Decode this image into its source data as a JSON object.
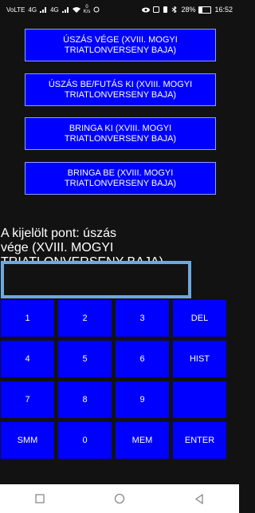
{
  "status_bar": {
    "left_labels": [
      "VoLTE",
      "4G",
      "4G"
    ],
    "speed_value": "0",
    "speed_unit": "K/s",
    "battery": "28%",
    "battery_fraction": 0.28,
    "time": "16:52"
  },
  "point_buttons": [
    {
      "line1": "ÚSZÁS VÉGE (XVIII. MOGYI",
      "line2": "TRIATLONVERSENY BAJA)"
    },
    {
      "line1": "ÚSZÁS BE/FUTÁS KI (XVIII. MOGYI",
      "line2": "TRIATLONVERSENY BAJA)"
    },
    {
      "line1": "BRINGA KI (XVIII. MOGYI",
      "line2": "TRIATLONVERSENY BAJA)"
    },
    {
      "line1": "BRINGA BE (XVIII. MOGYI",
      "line2": "TRIATLONVERSENY BAJA)"
    }
  ],
  "selected_point": {
    "line1": "A kijelölt pont: úszás",
    "line2": "vége (XVIII. MOGYI",
    "line3": "TRIATLONVERSENY BAJA)"
  },
  "input": {
    "value": ""
  },
  "keypad": [
    {
      "label": "1"
    },
    {
      "label": "2"
    },
    {
      "label": "3"
    },
    {
      "label": "DEL"
    },
    {
      "label": "4"
    },
    {
      "label": "5"
    },
    {
      "label": "6"
    },
    {
      "label": "HIST"
    },
    {
      "label": "7"
    },
    {
      "label": "8"
    },
    {
      "label": "9"
    },
    {
      "label": ""
    },
    {
      "label": "SMM"
    },
    {
      "label": "0"
    },
    {
      "label": "MEM"
    },
    {
      "label": "ENTER"
    }
  ],
  "nav_bar": {
    "icons": [
      "square-icon",
      "circle-icon",
      "triangle-icon"
    ]
  },
  "colors": {
    "button_blue": "#0000ff",
    "background": "#121212",
    "input_border": "#6fa8dc"
  }
}
